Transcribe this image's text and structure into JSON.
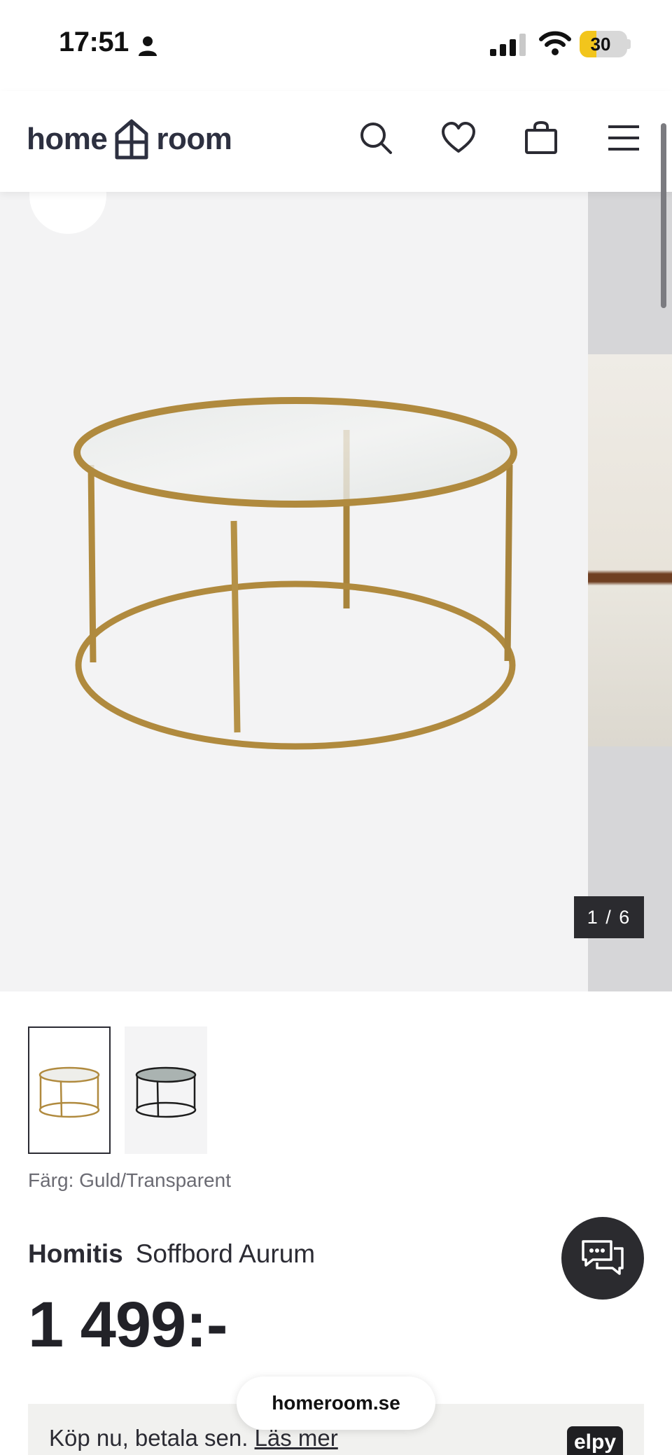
{
  "status_bar": {
    "time": "17:51",
    "battery": "30",
    "person_icon": "person-icon",
    "signal_icon": "cellular-signal-icon",
    "wifi_icon": "wifi-icon",
    "battery_icon": "battery-icon",
    "battery_color": "#f2c51c"
  },
  "header": {
    "logo_left": "home",
    "logo_right": "room",
    "logo_icon": "house-logo-icon",
    "icons": [
      "search-icon",
      "heart-icon",
      "shopping-bag-icon",
      "menu-icon"
    ]
  },
  "gallery": {
    "counter": "1 / 6",
    "current_index": 1,
    "total": 6
  },
  "thumbnails": [
    {
      "name": "gold-table-thumbnail",
      "selected": true
    },
    {
      "name": "black-table-thumbnail",
      "selected": false
    }
  ],
  "product": {
    "color_label": "Färg: Guld/Transparent",
    "brand": "Homitis",
    "name": "Soffbord Aurum",
    "price": "1 499:-"
  },
  "payment": {
    "text": "Köp nu, betala sen.",
    "link": "Läs mer",
    "badge": "elpy"
  },
  "browser": {
    "url": "homeroom.se"
  },
  "colors": {
    "accent_dark": "#2b2b33",
    "gold": "#b08a3e",
    "gallery_bg": "#f3f3f4"
  }
}
